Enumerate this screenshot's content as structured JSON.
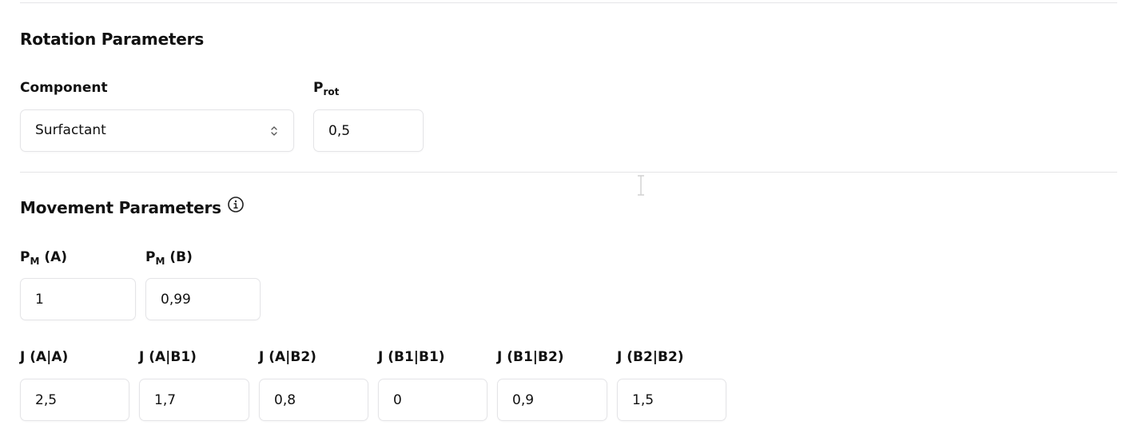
{
  "rotation": {
    "title": "Rotation Parameters",
    "component_label": "Component",
    "component_value": "Surfactant",
    "prot_label_main": "P",
    "prot_label_sub": "rot",
    "prot_value": "0,5"
  },
  "movement": {
    "title": "Movement Parameters",
    "info_icon": "info-circle-icon",
    "pm": [
      {
        "label_main": "P",
        "label_sub": "M",
        "label_suffix": " (A)",
        "value": "1"
      },
      {
        "label_main": "P",
        "label_sub": "M",
        "label_suffix": " (B)",
        "value": "0,99"
      }
    ],
    "j": [
      {
        "label": "J (A|A)",
        "value": "2,5"
      },
      {
        "label": "J (A|B1)",
        "value": "1,7"
      },
      {
        "label": "J (A|B2)",
        "value": "0,8"
      },
      {
        "label": "J (B1|B1)",
        "value": "0"
      },
      {
        "label": "J (B1|B2)",
        "value": "0,9"
      },
      {
        "label": "J (B2|B2)",
        "value": "1,5"
      }
    ]
  },
  "colors": {
    "border": "#e4e4e7",
    "text": "#111111",
    "icon": "#222222"
  }
}
